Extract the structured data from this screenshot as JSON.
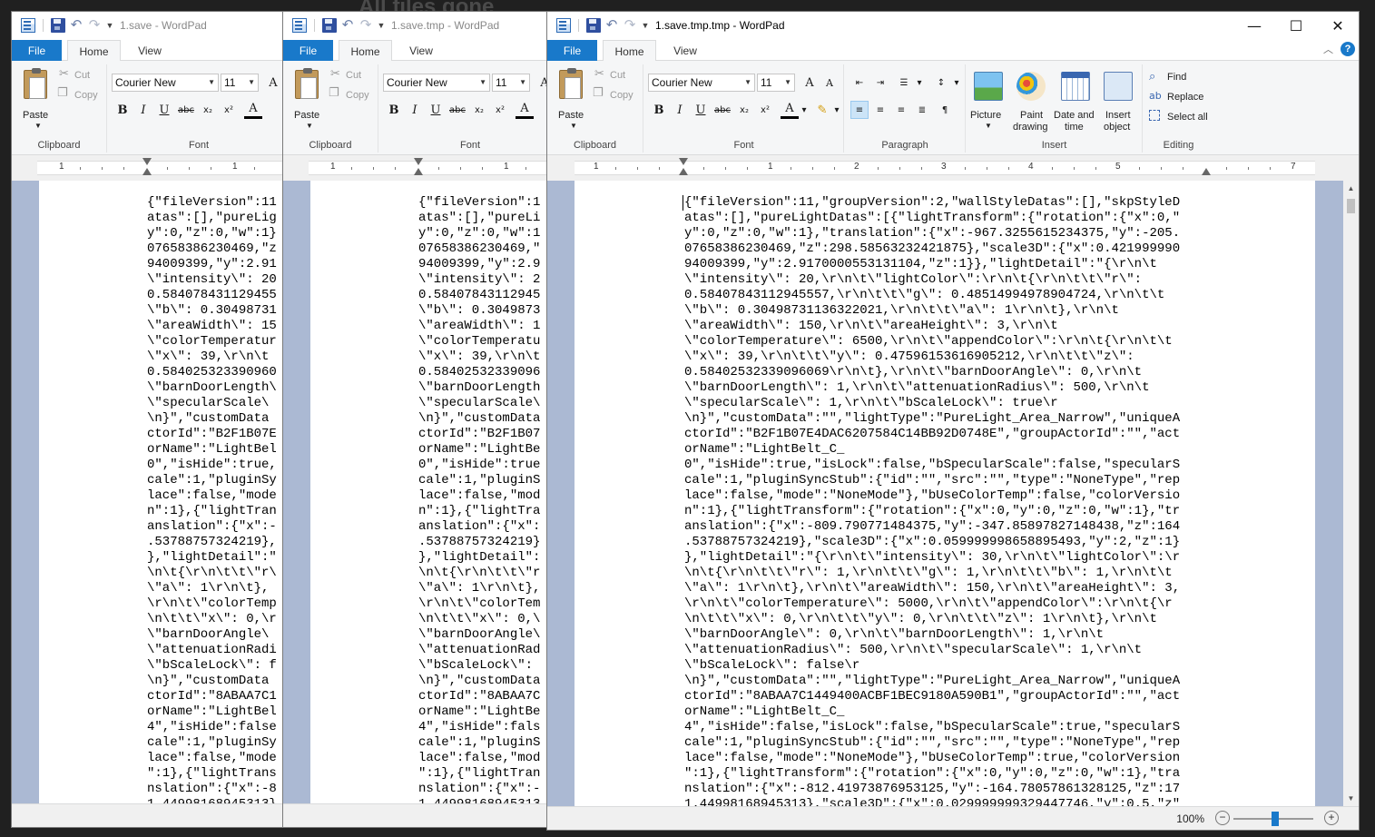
{
  "desktop": {
    "title": "All files gone"
  },
  "ribbon": {
    "tabs": {
      "file": "File",
      "home": "Home",
      "view": "View"
    },
    "clipboard": {
      "paste": "Paste",
      "cut": "Cut",
      "copy": "Copy",
      "group": "Clipboard"
    },
    "font": {
      "family": "Courier New",
      "size": "11",
      "group": "Font"
    },
    "paragraph": {
      "group": "Paragraph"
    },
    "insert": {
      "picture": "Picture",
      "paint_line1": "Paint",
      "paint_line2": "drawing",
      "date_line1": "Date and",
      "date_line2": "time",
      "object_line1": "Insert",
      "object_line2": "object",
      "group": "Insert"
    },
    "editing": {
      "find": "Find",
      "replace": "Replace",
      "select_all": "Select all",
      "group": "Editing"
    }
  },
  "windows": [
    {
      "title": "1.save - WordPad",
      "lines": [
        "{\"fileVersion\":11",
        "atas\":[],\"pureLig",
        "y\":0,\"z\":0,\"w\":1}",
        "07658386230469,\"z",
        "94009399,\"y\":2.91",
        "\\\"intensity\\\": 20",
        "0.584078431129455",
        "\\\"b\\\": 0.30498731",
        "\\\"areaWidth\\\": 15",
        "\\\"colorTemperatur",
        "\\\"x\\\": 39,\\r\\n\\t",
        "0.584025323390960",
        "\\\"barnDoorLength\\",
        "\\\"specularScale\\",
        "\\n}\",\"customData",
        "ctorId\":\"B2F1B07E",
        "orName\":\"LightBel",
        "0\",\"isHide\":true,",
        "cale\":1,\"pluginSy",
        "lace\":false,\"mode",
        "n\":1},{\"lightTran",
        "anslation\":{\"x\":-",
        ".53788757324219},",
        "},\"lightDetail\":\"",
        "\\n\\t{\\r\\n\\t\\t\\\"r\\",
        "\\\"a\\\": 1\\r\\n\\t},",
        "\\r\\n\\t\\\"colorTemp",
        "\\n\\t\\t\\\"x\\\": 0,\\r",
        "\\\"barnDoorAngle\\",
        "\\\"attenuationRadi",
        "\\\"bScaleLock\\\": f",
        "\\n}\",\"customData",
        "ctorId\":\"8ABAA7C1",
        "orName\":\"LightBel",
        "4\",\"isHide\":false",
        "cale\":1,\"pluginSy",
        "lace\":false,\"mode",
        "\":1},{\"lightTrans",
        "nslation\":{\"x\":-8",
        "1.44998168945313}"
      ]
    },
    {
      "title": "1.save.tmp - WordPad",
      "lines": [
        "{\"fileVersion\":1",
        "atas\":[],\"pureLi",
        "y\":0,\"z\":0,\"w\":1",
        "07658386230469,\"",
        "94009399,\"y\":2.9",
        "\\\"intensity\\\": 2",
        "0.58407843112945",
        "\\\"b\\\": 0.3049873",
        "\\\"areaWidth\\\": 1",
        "\\\"colorTemperatu",
        "\\\"x\\\": 39,\\r\\n\\t",
        "0.58402532339096",
        "\\\"barnDoorLength",
        "\\\"specularScale\\",
        "\\n}\",\"customData",
        "ctorId\":\"B2F1B07",
        "orName\":\"LightBe",
        "0\",\"isHide\":true",
        "cale\":1,\"pluginS",
        "lace\":false,\"mod",
        "n\":1},{\"lightTra",
        "anslation\":{\"x\":",
        ".53788757324219}",
        "},\"lightDetail\":",
        "\\n\\t{\\r\\n\\t\\t\\\"r",
        "\\\"a\\\": 1\\r\\n\\t},",
        "\\r\\n\\t\\\"colorTem",
        "\\n\\t\\t\\\"x\\\": 0,\\",
        "\\\"barnDoorAngle\\",
        "\\\"attenuationRad",
        "\\\"bScaleLock\\\": ",
        "\\n}\",\"customData",
        "ctorId\":\"8ABAA7C",
        "orName\":\"LightBe",
        "4\",\"isHide\":fals",
        "cale\":1,\"pluginS",
        "lace\":false,\"mod",
        "\":1},{\"lightTran",
        "nslation\":{\"x\":-",
        "1.44998168945313"
      ]
    },
    {
      "title": "1.save.tmp.tmp - WordPad",
      "zoom": "100%",
      "lines": [
        "{\"fileVersion\":11,\"groupVersion\":2,\"wallStyleDatas\":[],\"skpStyleD",
        "atas\":[],\"pureLightDatas\":[{\"lightTransform\":{\"rotation\":{\"x\":0,\"",
        "y\":0,\"z\":0,\"w\":1},\"translation\":{\"x\":-967.3255615234375,\"y\":-205.",
        "07658386230469,\"z\":298.58563232421875},\"scale3D\":{\"x\":0.421999990",
        "94009399,\"y\":2.9170000553131104,\"z\":1}},\"lightDetail\":\"{\\r\\n\\t",
        "\\\"intensity\\\": 20,\\r\\n\\t\\\"lightColor\\\":\\r\\n\\t{\\r\\n\\t\\t\\\"r\\\":",
        "0.58407843112945557,\\r\\n\\t\\t\\\"g\\\": 0.48514994978904724,\\r\\n\\t\\t",
        "\\\"b\\\": 0.30498731136322021,\\r\\n\\t\\t\\\"a\\\": 1\\r\\n\\t},\\r\\n\\t",
        "\\\"areaWidth\\\": 150,\\r\\n\\t\\\"areaHeight\\\": 3,\\r\\n\\t",
        "\\\"colorTemperature\\\": 6500,\\r\\n\\t\\\"appendColor\\\":\\r\\n\\t{\\r\\n\\t\\t",
        "\\\"x\\\": 39,\\r\\n\\t\\t\\\"y\\\": 0.47596153616905212,\\r\\n\\t\\t\\\"z\\\":",
        "0.58402532339096069\\r\\n\\t},\\r\\n\\t\\\"barnDoorAngle\\\": 0,\\r\\n\\t",
        "\\\"barnDoorLength\\\": 1,\\r\\n\\t\\\"attenuationRadius\\\": 500,\\r\\n\\t",
        "\\\"specularScale\\\": 1,\\r\\n\\t\\\"bScaleLock\\\": true\\r",
        "\\n}\",\"customData\":\"\",\"lightType\":\"PureLight_Area_Narrow\",\"uniqueA",
        "ctorId\":\"B2F1B07E4DAC6207584C14BB92D0748E\",\"groupActorId\":\"\",\"act",
        "orName\":\"LightBelt_C_",
        "0\",\"isHide\":true,\"isLock\":false,\"bSpecularScale\":false,\"specularS",
        "cale\":1,\"pluginSyncStub\":{\"id\":\"\",\"src\":\"\",\"type\":\"NoneType\",\"rep",
        "lace\":false,\"mode\":\"NoneMode\"},\"bUseColorTemp\":false,\"colorVersio",
        "n\":1},{\"lightTransform\":{\"rotation\":{\"x\":0,\"y\":0,\"z\":0,\"w\":1},\"tr",
        "anslation\":{\"x\":-809.790771484375,\"y\":-347.85897827148438,\"z\":164",
        ".53788757324219},\"scale3D\":{\"x\":0.059999998658895493,\"y\":2,\"z\":1}",
        "},\"lightDetail\":\"{\\r\\n\\t\\\"intensity\\\": 30,\\r\\n\\t\\\"lightColor\\\":\\r",
        "\\n\\t{\\r\\n\\t\\t\\\"r\\\": 1,\\r\\n\\t\\t\\\"g\\\": 1,\\r\\n\\t\\t\\\"b\\\": 1,\\r\\n\\t\\t",
        "\\\"a\\\": 1\\r\\n\\t},\\r\\n\\t\\\"areaWidth\\\": 150,\\r\\n\\t\\\"areaHeight\\\": 3,",
        "\\r\\n\\t\\\"colorTemperature\\\": 5000,\\r\\n\\t\\\"appendColor\\\":\\r\\n\\t{\\r",
        "\\n\\t\\t\\\"x\\\": 0,\\r\\n\\t\\t\\\"y\\\": 0,\\r\\n\\t\\t\\\"z\\\": 1\\r\\n\\t},\\r\\n\\t",
        "\\\"barnDoorAngle\\\": 0,\\r\\n\\t\\\"barnDoorLength\\\": 1,\\r\\n\\t",
        "\\\"attenuationRadius\\\": 500,\\r\\n\\t\\\"specularScale\\\": 1,\\r\\n\\t",
        "\\\"bScaleLock\\\": false\\r",
        "\\n}\",\"customData\":\"\",\"lightType\":\"PureLight_Area_Narrow\",\"uniqueA",
        "ctorId\":\"8ABAA7C1449400ACBF1BEC9180A590B1\",\"groupActorId\":\"\",\"act",
        "orName\":\"LightBelt_C_",
        "4\",\"isHide\":false,\"isLock\":false,\"bSpecularScale\":true,\"specularS",
        "cale\":1,\"pluginSyncStub\":{\"id\":\"\",\"src\":\"\",\"type\":\"NoneType\",\"rep",
        "lace\":false,\"mode\":\"NoneMode\"},\"bUseColorTemp\":true,\"colorVersion",
        "\":1},{\"lightTransform\":{\"rotation\":{\"x\":0,\"y\":0,\"z\":0,\"w\":1},\"tra",
        "nslation\":{\"x\":-812.41973876953125,\"y\":-164.78057861328125,\"z\":17",
        "1.44998168945313},\"scale3D\":{\"x\":0.029999999329447746,\"y\":0.5,\"z\""
      ]
    }
  ]
}
